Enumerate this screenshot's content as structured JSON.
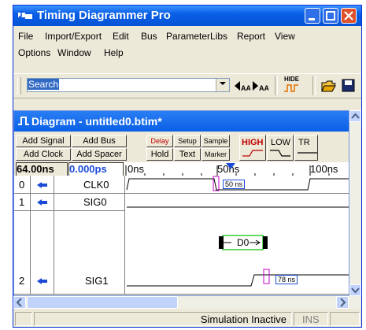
{
  "app": {
    "title": "Timing Diagrammer Pro"
  },
  "menu": {
    "row1": [
      {
        "label": "File"
      },
      {
        "label": "Import/Export"
      },
      {
        "label": "Edit"
      },
      {
        "label": "Bus"
      },
      {
        "label": "ParameterLibs"
      },
      {
        "label": "Report"
      },
      {
        "label": "View"
      }
    ],
    "row2": [
      {
        "label": "Options"
      },
      {
        "label": "Window"
      },
      {
        "label": "Help"
      }
    ]
  },
  "toolbar": {
    "search_value": "Search",
    "hide_label": "HIDE"
  },
  "diagram": {
    "title": "Diagram - untitled0.btim*",
    "buttons": {
      "add_signal": "Add Signal",
      "add_bus": "Add Bus",
      "add_clock": "Add Clock",
      "add_spacer": "Add Spacer",
      "delay": "Delay",
      "setup": "Setup",
      "sample": "Sample",
      "hold": "Hold",
      "text": "Text",
      "marker": "Marker",
      "high": "HIGH",
      "low": "LOW",
      "tri": "TR"
    },
    "time_left": "64.00ns",
    "time_right": "0.000ps",
    "ticks": [
      "0ns",
      "50ns",
      "100ns"
    ],
    "signals": [
      {
        "index": "0",
        "name": "CLK0"
      },
      {
        "index": "1",
        "name": "SIG0"
      },
      {
        "index": "2",
        "name": "SIG1"
      }
    ],
    "annotations": {
      "clk_delay": "50 ns",
      "bus_value": "D0",
      "sig1_delay": "78 ns"
    }
  },
  "status": {
    "text": "Simulation Inactive",
    "ins": "INS"
  },
  "colors": {
    "titlebar": "#0553d6",
    "accent_red": "#c00000",
    "marker_blue": "#1c4ad6",
    "bus_green": "#00c000",
    "delay_magenta": "#c000c0"
  }
}
